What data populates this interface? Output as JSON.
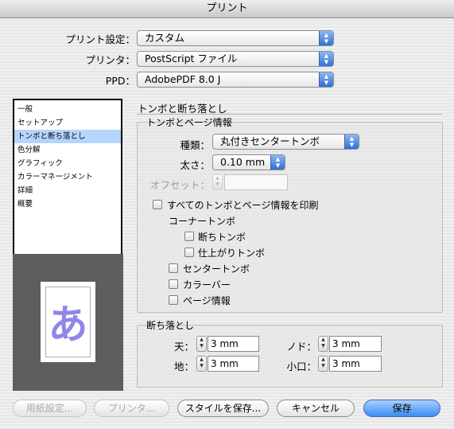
{
  "window": {
    "title": "プリント"
  },
  "top_settings": {
    "preset_label": "プリント設定：",
    "preset_value": "カスタム",
    "printer_label": "プリンタ：",
    "printer_value": "PostScript ファイル",
    "ppd_label": "PPD：",
    "ppd_value": "AdobePDF 8.0 J"
  },
  "sidebar": {
    "items": [
      {
        "label": "一般"
      },
      {
        "label": "セットアップ"
      },
      {
        "label": "トンボと断ち落とし",
        "selected": true
      },
      {
        "label": "色分解"
      },
      {
        "label": "グラフィック"
      },
      {
        "label": "カラーマネージメント"
      },
      {
        "label": "詳細"
      },
      {
        "label": "概要"
      }
    ]
  },
  "preview": {
    "glyph": "あ"
  },
  "panel": {
    "title": "トンボと断ち落とし",
    "marks_group": {
      "title": "トンボとページ情報",
      "type_label": "種類：",
      "type_value": "丸付きセンタートンボ",
      "weight_label": "太さ：",
      "weight_value": "0.10 mm",
      "offset_label": "オフセット：",
      "offset_value": "",
      "print_all_label": "すべてのトンボとページ情報を印刷",
      "corner_marks_heading": "コーナートンボ",
      "bleed_marks_label": "断ちトンボ",
      "trim_marks_label": "仕上がりトンボ",
      "center_marks_label": "センタートンボ",
      "color_bars_label": "カラーバー",
      "page_info_label": "ページ情報"
    },
    "bleed_group": {
      "title": "断ち落とし",
      "top_label": "天：",
      "top_value": "3 mm",
      "bottom_label": "地：",
      "bottom_value": "3 mm",
      "inside_label": "ノド：",
      "inside_value": "3 mm",
      "outside_label": "小口：",
      "outside_value": "3 mm"
    }
  },
  "buttons": {
    "page_setup": "用紙設定...",
    "printer": "プリンタ...",
    "save_style": "スタイルを保存...",
    "cancel": "キャンセル",
    "save": "保存"
  },
  "colors": {
    "accent": "#3d8cf0",
    "selection": "#b5d5ff",
    "preview_glyph": "#8f86e8"
  }
}
